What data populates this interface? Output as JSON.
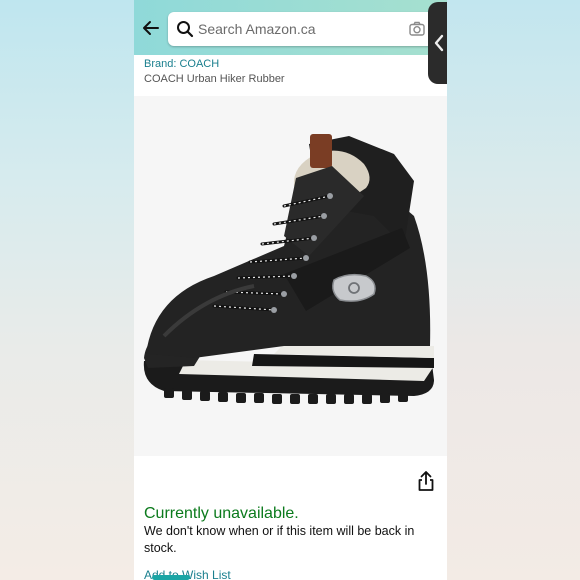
{
  "header": {
    "search_placeholder": "Search Amazon.ca"
  },
  "product": {
    "brand_label": "Brand: COACH",
    "title": "COACH Urban Hiker Rubber"
  },
  "availability": {
    "status": "Currently unavailable.",
    "message": "We don't know when or if this item will be back in stock."
  },
  "actions": {
    "wishlist_label": "Add to Wish List"
  },
  "colors": {
    "header_bg": "#8fd9d9",
    "brand_link": "#1a7f8e",
    "availability": "#0b7a1c"
  },
  "icons": [
    "back-arrow-icon",
    "search-icon",
    "camera-icon",
    "chevron-left-icon",
    "share-icon"
  ]
}
